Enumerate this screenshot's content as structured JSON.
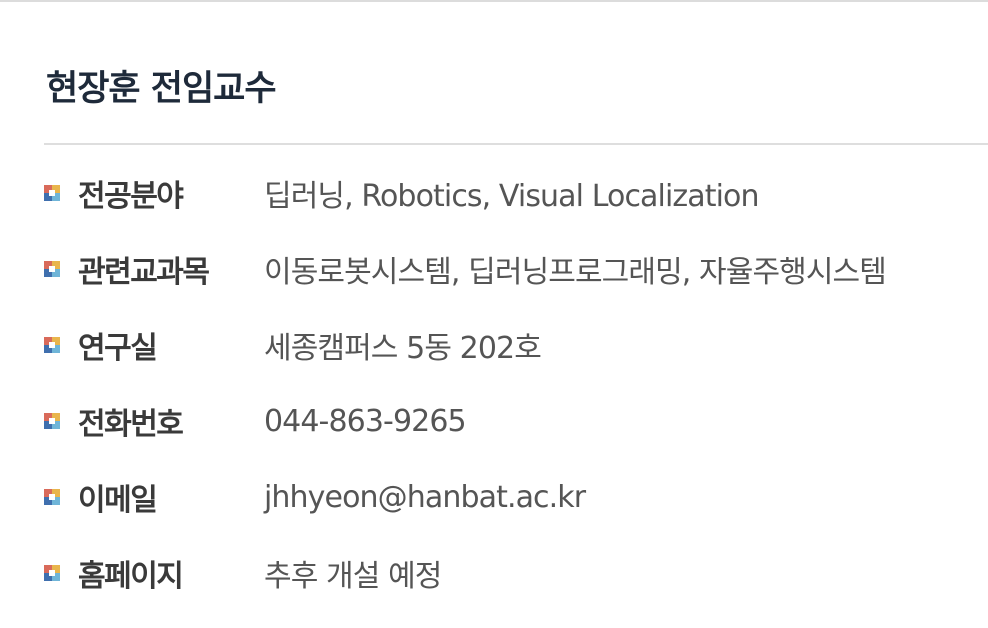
{
  "profile": {
    "name_title": "현장훈 전임교수",
    "rows": [
      {
        "label": "전공분야",
        "value": "딥러닝, Robotics, Visual Localization"
      },
      {
        "label": "관련교과목",
        "value": "이동로봇시스템, 딥러닝프로그래밍, 자율주행시스템"
      },
      {
        "label": "연구실",
        "value": "세종캠퍼스 5동 202호"
      },
      {
        "label": "전화번호",
        "value": "044-863-9265"
      },
      {
        "label": "이메일",
        "value": "jhhyeon@hanbat.ac.kr"
      },
      {
        "label": "홈페이지",
        "value": "추후 개설 예정"
      }
    ]
  },
  "colors": {
    "title": "#1e2a3a",
    "label": "#3a3a3a",
    "value": "#555555",
    "divider": "#dedede",
    "bullet": [
      "#d96a5a",
      "#e9b54c",
      "#3f6fae",
      "#6fb5d8"
    ]
  },
  "icons": {
    "bullet": "square-bullet-icon"
  }
}
